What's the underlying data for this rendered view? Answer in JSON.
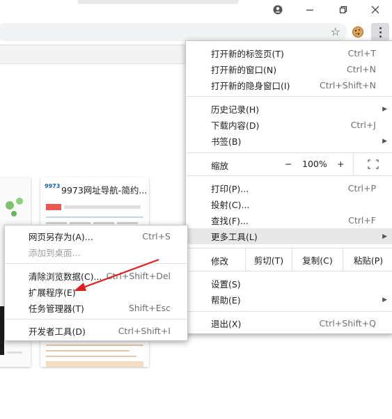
{
  "window": {
    "controls": {
      "profile_icon": "account-circle-icon",
      "minimize_icon": "minimize-icon",
      "restore_icon": "restore-icon",
      "close_icon": "close-icon"
    }
  },
  "toolbar": {
    "bookmark_icon": "star-icon",
    "extension_icon": "cookie-icon",
    "menu_icon": "kebab-menu-icon"
  },
  "thumbnails": [
    {
      "title": "9973网址导航-简约..."
    }
  ],
  "main_menu": {
    "items_group1": [
      {
        "label": "打开新的标签页(T)",
        "shortcut": "Ctrl+T"
      },
      {
        "label": "打开新的窗口(N)",
        "shortcut": "Ctrl+N"
      },
      {
        "label": "打开新的隐身窗口(I)",
        "shortcut": "Ctrl+Shift+N"
      }
    ],
    "items_group2": [
      {
        "label": "历史记录(H)",
        "shortcut": ""
      },
      {
        "label": "下载内容(D)",
        "shortcut": "Ctrl+J"
      },
      {
        "label": "书签(B)",
        "shortcut": ""
      }
    ],
    "zoom": {
      "label": "缩放",
      "minus": "−",
      "value": "100%",
      "plus": "+"
    },
    "items_group3": [
      {
        "label": "打印(P)...",
        "shortcut": "Ctrl+P"
      },
      {
        "label": "投射(C)...",
        "shortcut": ""
      },
      {
        "label": "查找(F)...",
        "shortcut": "Ctrl+F"
      },
      {
        "label": "更多工具(L)",
        "shortcut": ""
      }
    ],
    "edit": {
      "label": "修改",
      "cut": "剪切(T)",
      "copy": "复制(C)",
      "paste": "粘贴(P)"
    },
    "items_group4": [
      {
        "label": "设置(S)",
        "shortcut": ""
      },
      {
        "label": "帮助(E)",
        "shortcut": ""
      }
    ],
    "exit": {
      "label": "退出(X)",
      "shortcut": "Ctrl+Shift+Q"
    }
  },
  "sub_menu": {
    "items_group1": [
      {
        "label": "网页另存为(A)...",
        "shortcut": "Ctrl+S"
      },
      {
        "label": "添加到桌面...",
        "shortcut": ""
      }
    ],
    "items_group2": [
      {
        "label": "清除浏览数据(C)...",
        "shortcut": "Ctrl+Shift+Del"
      },
      {
        "label": "扩展程序(E)",
        "shortcut": ""
      },
      {
        "label": "任务管理器(T)",
        "shortcut": "Shift+Esc"
      }
    ],
    "items_group3": [
      {
        "label": "开发者工具(D)",
        "shortcut": "Ctrl+Shift+I"
      }
    ]
  },
  "colors": {
    "arrow": "#e02020",
    "highlight": "#e8e8e8"
  }
}
